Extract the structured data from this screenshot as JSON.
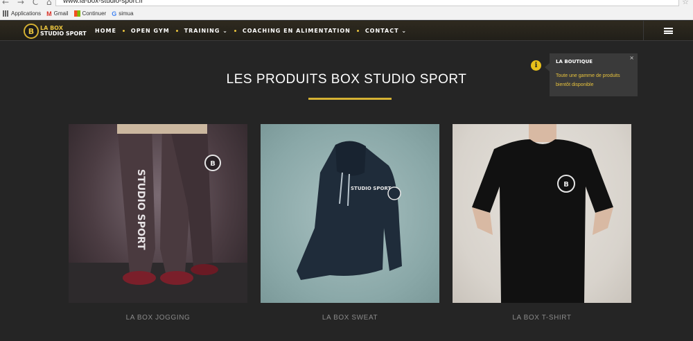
{
  "browser": {
    "nav_glyphs": "← → C ⌂",
    "url": "www.la-box-studio-sport.fr",
    "bookmarks": [
      {
        "label": "Applications",
        "icon": "apps-grid-icon"
      },
      {
        "label": "Gmail",
        "icon": "gmail-icon",
        "glyph": "M"
      },
      {
        "label": "Continuer",
        "icon": "microsoft-icon"
      },
      {
        "label": "simua",
        "icon": "google-icon",
        "glyph": "G"
      }
    ]
  },
  "site": {
    "logo": {
      "badge": "B",
      "line1": "LA BOX",
      "line2": "STUDIO SPORT"
    },
    "menu": [
      "HOME",
      "OPEN GYM",
      "TRAINING ⌄",
      "COACHING EN ALIMENTATION",
      "CONTACT ⌄"
    ],
    "accent": "#d5b133"
  },
  "page": {
    "title": "LES PRODUITS BOX STUDIO SPORT",
    "products": [
      {
        "label": "LA BOX JOGGING",
        "graphic_text": "STUDIO SPORT"
      },
      {
        "label": "LA BOX SWEAT",
        "graphic_text": "STUDIO SPORT"
      },
      {
        "label": "LA BOX T-SHIRT"
      }
    ]
  },
  "notification": {
    "title": "LA BOUTIQUE",
    "body": "Toute une gamme de produits bientôt disponible",
    "close": "×",
    "icon": "info-icon",
    "icon_glyph": "i"
  }
}
